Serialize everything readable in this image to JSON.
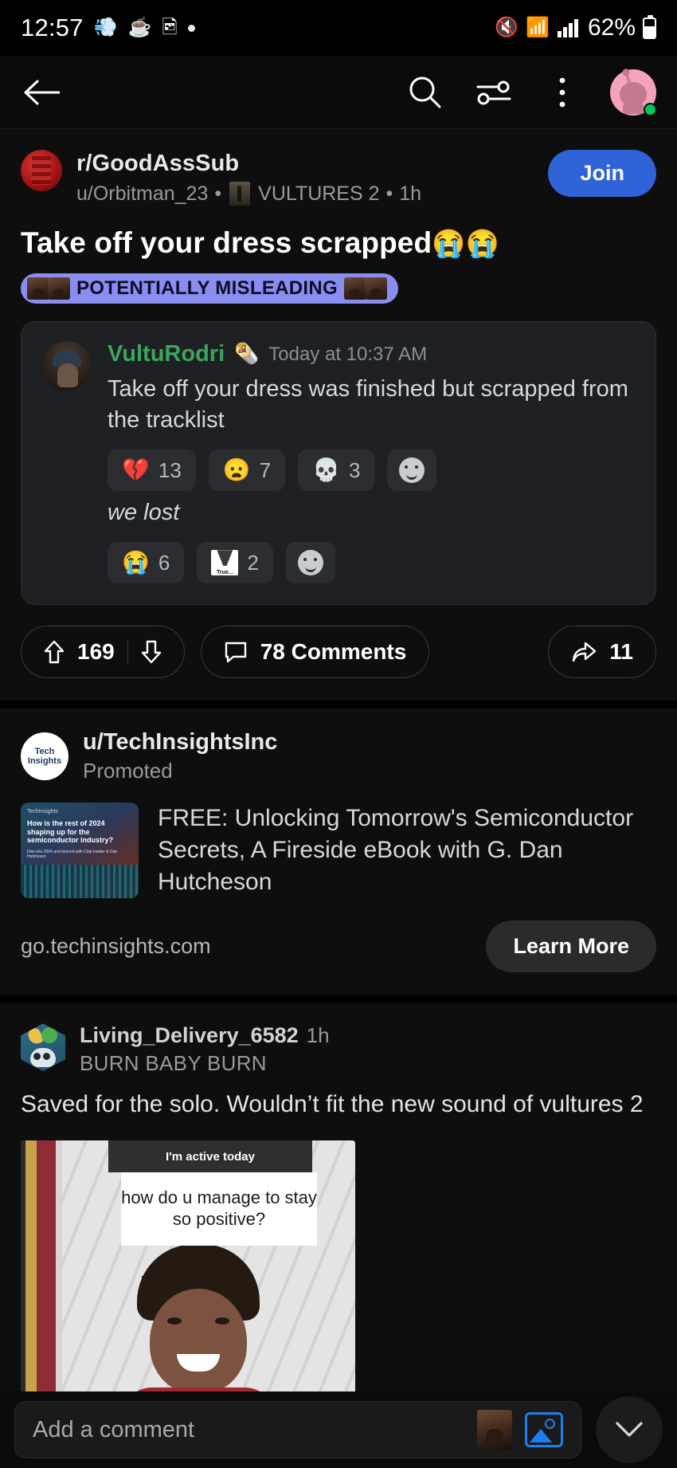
{
  "status_bar": {
    "time": "12:57",
    "left_icons": [
      "weather-icon",
      "tea-icon",
      "image-icon",
      "dot-icon"
    ],
    "right_icons": [
      "mute-icon",
      "wifi-icon",
      "signal-icon"
    ],
    "battery_percent": "62%"
  },
  "nav": {
    "back_icon": "back-arrow-icon",
    "search_icon": "search-icon",
    "sort_icon": "sort-sliders-icon",
    "overflow_icon": "overflow-menu-icon",
    "avatar": "user-avatar"
  },
  "post": {
    "subreddit": "r/GoodAssSub",
    "author": "u/Orbitman_23",
    "separator_1": "•",
    "user_flair": "VULTURES 2",
    "separator_2": "•",
    "age": "1h",
    "join_label": "Join",
    "title": "Take off your dress scrapped",
    "title_emoji": "😭😭",
    "post_flair": "POTENTIALLY MISLEADING",
    "embed": {
      "username": "VultuRodri",
      "badge_emoji": "🌯",
      "timestamp": "Today at 10:37 AM",
      "messages": [
        {
          "text": "Take off your dress was finished but scrapped from the tracklist",
          "italic": false,
          "reactions": [
            {
              "emoji": "💔",
              "count": "13",
              "name": "broken-heart"
            },
            {
              "emoji": "😦",
              "count": "7",
              "name": "frowning-face"
            },
            {
              "emoji": "💀",
              "count": "3",
              "name": "skull"
            }
          ],
          "add_reaction": "add-reaction"
        },
        {
          "text": "we lost",
          "italic": true,
          "reactions": [
            {
              "emoji": "😭",
              "count": "6",
              "name": "loudly-crying"
            },
            {
              "emoji": "custom-true",
              "count": "2",
              "name": "true-custom-emoji",
              "label": "True..."
            }
          ],
          "add_reaction": "add-reaction"
        }
      ]
    },
    "actions": {
      "upvote_icon": "upvote-arrow-icon",
      "score": "169",
      "downvote_icon": "downvote-arrow-icon",
      "comment_icon": "comment-bubble-icon",
      "comments_label": "78 Comments",
      "share_icon": "share-arrow-icon",
      "share_count": "11"
    }
  },
  "ad": {
    "avatar_line1": "Tech",
    "avatar_line2": "Insights",
    "username": "u/TechInsightsInc",
    "promoted_label": "Promoted",
    "thumb_kicker": "TechInsights",
    "thumb_headline": "How is the rest of 2024 shaping up for the semiconductor industry?",
    "thumb_sub": "Dive into 2024 and beyond with Chip Insider & Dan Hutcheson",
    "title": "FREE: Unlocking Tomorrow's Semiconductor Secrets, A Fireside eBook with G. Dan Hutcheson",
    "url": "go.techinsights.com",
    "cta_label": "Learn More"
  },
  "comment": {
    "username": "Living_Delivery_6582",
    "age": "1h",
    "flair": "BURN BABY BURN",
    "text": "Saved for the solo. Wouldn’t fit the new sound of vultures 2",
    "image": {
      "banner_text": "I'm active today",
      "question_text": "how do u manage to stay so positive?"
    }
  },
  "bottom_bar": {
    "comment_placeholder": "Add a comment",
    "avatar_icon": "user-thumbnail-icon",
    "image_icon": "image-attach-icon",
    "collapse_icon": "chevron-down-icon"
  },
  "colors": {
    "background": "#000000",
    "surface": "#0e0e0e",
    "join_blue": "#3063d8",
    "flair_badge": "#8a8df0",
    "discord_card": "#1e2023",
    "discord_username": "#3ba55c",
    "image_icon_blue": "#1e7ef0",
    "online_green": "#00c853"
  }
}
